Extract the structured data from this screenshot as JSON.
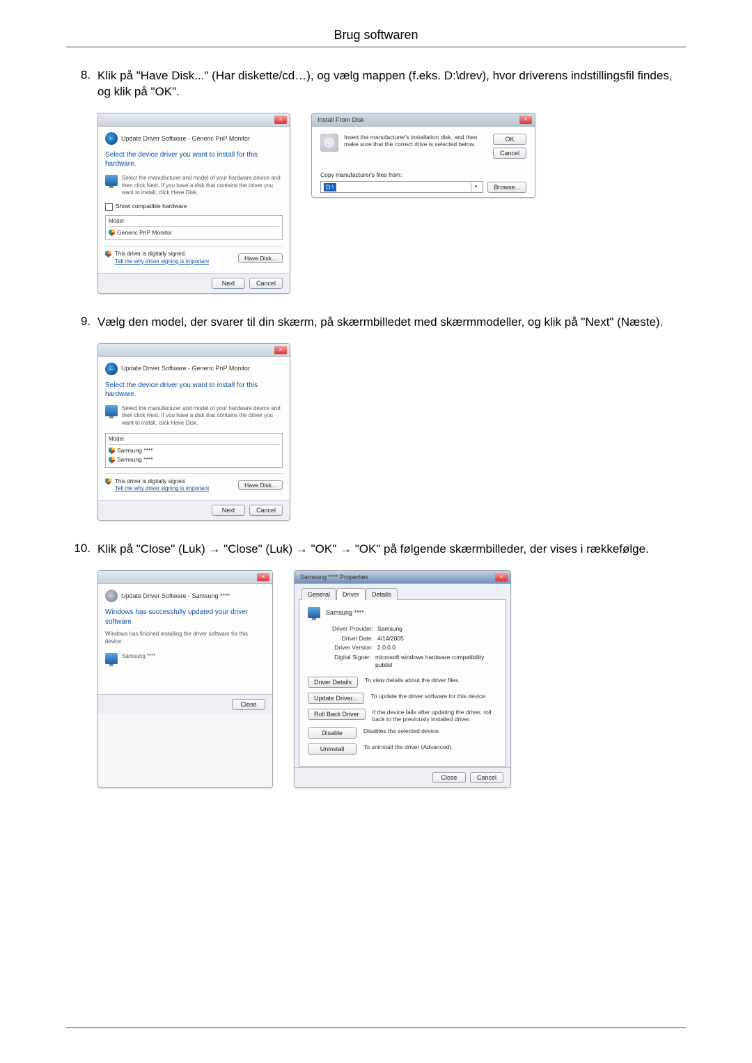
{
  "page": {
    "header": "Brug softwaren"
  },
  "steps": {
    "s8": {
      "num": "8.",
      "text": "Klik på \"Have Disk...\" (Har diskette/cd…), og vælg mappen (f.eks. D:\\drev), hvor driverens indstillingsfil findes, og klik på \"OK\"."
    },
    "s9": {
      "num": "9.",
      "text": "Vælg den model, der svarer til din skærm, på skærmbilledet med skærmmodeller, og klik på \"Next\" (Næste)."
    },
    "s10": {
      "num": "10.",
      "text": "Klik på \"Close\" (Luk) → \"Close\" (Luk) → \"OK\" → \"OK\" på følgende skærmbilleder, der vises i rækkefølge."
    }
  },
  "dlg_driver_generic": {
    "bread": "Update Driver Software - Generic PnP Monitor",
    "head": "Select the device driver you want to install for this hardware.",
    "instr": "Select the manufacturer and model of your hardware device and then click Next. If you have a disk that contains the driver you want to install, click Have Disk.",
    "show_compat": "Show compatible hardware",
    "model_col": "Model",
    "model_item": "Generic PnP Monitor",
    "signed": "This driver is digitally signed.",
    "signed_link": "Tell me why driver signing is important",
    "have_disk": "Have Disk...",
    "next": "Next",
    "cancel": "Cancel"
  },
  "dlg_install_disk": {
    "title": "Install From Disk",
    "msg": "Insert the manufacturer's installation disk, and then make sure that the correct drive is selected below.",
    "ok": "OK",
    "cancel": "Cancel",
    "copy_label": "Copy manufacturer's files from:",
    "path": "D:\\",
    "browse": "Browse..."
  },
  "dlg_driver_samsung": {
    "bread": "Update Driver Software - Generic PnP Monitor",
    "head": "Select the device driver you want to install for this hardware.",
    "instr": "Select the manufacturer and model of your hardware device and then click Next. If you have a disk that contains the driver you want to install, click Have Disk.",
    "model_col": "Model",
    "model_item1": "Samsung ****",
    "model_item2": "Samsung ****",
    "signed": "This driver is digitally signed.",
    "signed_link": "Tell me why driver signing is important",
    "have_disk": "Have Disk...",
    "next": "Next",
    "cancel": "Cancel"
  },
  "dlg_update_done": {
    "bread": "Update Driver Software - Samsung ****",
    "head": "Windows has successfully updated your driver software",
    "sub": "Windows has finished installing the driver software for this device:",
    "device": "Samsung ****",
    "close": "Close"
  },
  "dlg_props": {
    "title": "Samsung **** Properties",
    "tabs": {
      "general": "General",
      "driver": "Driver",
      "details": "Details"
    },
    "device": "Samsung ****",
    "rows": {
      "provider_l": "Driver Provider:",
      "provider_v": "Samsung",
      "date_l": "Driver Date:",
      "date_v": "4/14/2005",
      "version_l": "Driver Version:",
      "version_v": "2.0.0.0",
      "signer_l": "Digital Signer:",
      "signer_v": "microsoft windows hardware compatibility publisl"
    },
    "actions": {
      "details_btn": "Driver Details",
      "details_d": "To view details about the driver files.",
      "update_btn": "Update Driver...",
      "update_d": "To update the driver software for this device.",
      "rollback_btn": "Roll Back Driver",
      "rollback_d": "If the device fails after updating the driver, roll back to the previously installed driver.",
      "disable_btn": "Disable",
      "disable_d": "Disables the selected device.",
      "uninstall_btn": "Uninstall",
      "uninstall_d": "To uninstall the driver (Advanced)."
    },
    "close": "Close",
    "cancel": "Cancel"
  }
}
